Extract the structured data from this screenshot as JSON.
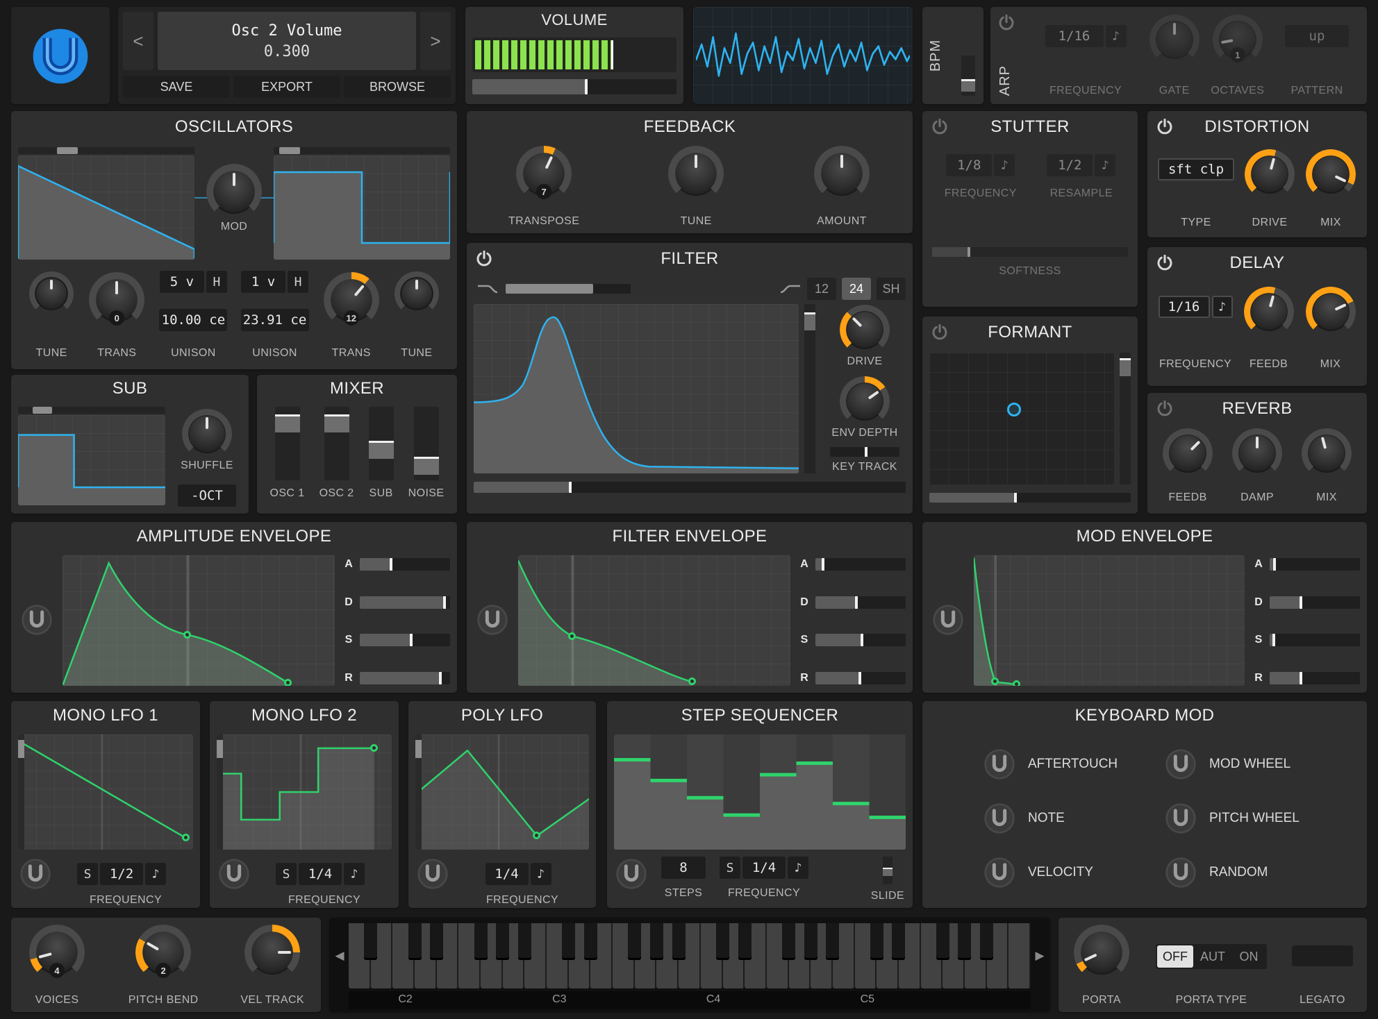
{
  "icons": {
    "note": "♪",
    "sync": "S",
    "prev": "<",
    "next": ">",
    "kb_left": "◀",
    "kb_right": "▶"
  },
  "header": {
    "patch": {
      "name": "Osc 2 Volume",
      "value": "0.300",
      "save": "SAVE",
      "export": "EXPORT",
      "browse": "BROWSE"
    },
    "volume_title": "VOLUME",
    "bpm_label": "BPM",
    "arp": {
      "label": "ARP",
      "frequency_value": "1/16",
      "frequency_label": "FREQUENCY",
      "gate_label": "GATE",
      "octaves_label": "OCTAVES",
      "octaves_value": "1",
      "pattern_label": "PATTERN",
      "pattern_value": "up"
    }
  },
  "oscillators": {
    "title": "OSCILLATORS",
    "mod_label": "MOD",
    "osc1": {
      "tune_label": "TUNE",
      "trans_label": "TRANS",
      "trans_value": "0",
      "unison_voices": "5 v",
      "harmonize": "H",
      "unison_cents": "10.00 ce",
      "unison_label": "UNISON"
    },
    "osc2": {
      "tune_label": "TUNE",
      "trans_label": "TRANS",
      "trans_value": "12",
      "unison_voices": "1 v",
      "harmonize": "H",
      "unison_cents": "23.91 ce",
      "unison_label": "UNISON"
    }
  },
  "feedback": {
    "title": "FEEDBACK",
    "transpose_label": "TRANSPOSE",
    "transpose_value": "7",
    "tune_label": "TUNE",
    "amount_label": "AMOUNT"
  },
  "filter": {
    "title": "FILTER",
    "pole_12": "12",
    "pole_24": "24",
    "pole_sh": "SH",
    "drive_label": "DRIVE",
    "env_depth_label": "ENV DEPTH",
    "key_track_label": "KEY TRACK"
  },
  "stutter": {
    "title": "STUTTER",
    "frequency_value": "1/8",
    "frequency_label": "FREQUENCY",
    "resample_value": "1/2",
    "resample_label": "RESAMPLE",
    "softness_label": "SOFTNESS"
  },
  "distortion": {
    "title": "DISTORTION",
    "type_value": "sft clp",
    "type_label": "TYPE",
    "drive_label": "DRIVE",
    "mix_label": "MIX"
  },
  "delay": {
    "title": "DELAY",
    "frequency_value": "1/16",
    "frequency_label": "FREQUENCY",
    "feedback_label": "FEEDB",
    "mix_label": "MIX"
  },
  "reverb": {
    "title": "REVERB",
    "feedback_label": "FEEDB",
    "damp_label": "DAMP",
    "mix_label": "MIX"
  },
  "formant": {
    "title": "FORMANT"
  },
  "sub": {
    "title": "SUB",
    "shuffle_label": "SHUFFLE",
    "octave_button": "-OCT"
  },
  "mixer": {
    "title": "MIXER",
    "channels": [
      "OSC 1",
      "OSC 2",
      "SUB",
      "NOISE"
    ]
  },
  "envelopes": {
    "letters": [
      "A",
      "D",
      "S",
      "R"
    ],
    "amp_title": "AMPLITUDE ENVELOPE",
    "filter_title": "FILTER ENVELOPE",
    "mod_title": "MOD ENVELOPE"
  },
  "lfo1": {
    "title": "MONO LFO 1",
    "frequency_value": "1/2",
    "frequency_label": "FREQUENCY"
  },
  "lfo2": {
    "title": "MONO LFO 2",
    "frequency_value": "1/4",
    "frequency_label": "FREQUENCY"
  },
  "poly_lfo": {
    "title": "POLY LFO",
    "frequency_value": "1/4",
    "frequency_label": "FREQUENCY"
  },
  "step_sequencer": {
    "title": "STEP SEQUENCER",
    "steps_value": "8",
    "steps_label": "STEPS",
    "frequency_value": "1/4",
    "frequency_label": "FREQUENCY",
    "slide_label": "SLIDE"
  },
  "keyboard_mod": {
    "title": "KEYBOARD MOD",
    "items": [
      {
        "label": "AFTERTOUCH"
      },
      {
        "label": "MOD WHEEL"
      },
      {
        "label": "NOTE"
      },
      {
        "label": "PITCH WHEEL"
      },
      {
        "label": "VELOCITY"
      },
      {
        "label": "RANDOM"
      }
    ]
  },
  "footer": {
    "voices_label": "VOICES",
    "voices_value": "4",
    "pitch_bend_label": "PITCH BEND",
    "pitch_bend_value": "2",
    "vel_track_label": "VEL TRACK",
    "octaves": [
      "C2",
      "C3",
      "C4",
      "C5"
    ],
    "porta_label": "PORTA",
    "porta_off": "OFF",
    "porta_aut": "AUT",
    "porta_on": "ON",
    "porta_type_label": "PORTA TYPE",
    "legato_label": "LEGATO"
  },
  "colors": {
    "accent_blue": "#2fb3f0",
    "accent_green": "#2fd36b",
    "accent_orange": "#ffa115",
    "meter_green": "#8ce24f"
  }
}
